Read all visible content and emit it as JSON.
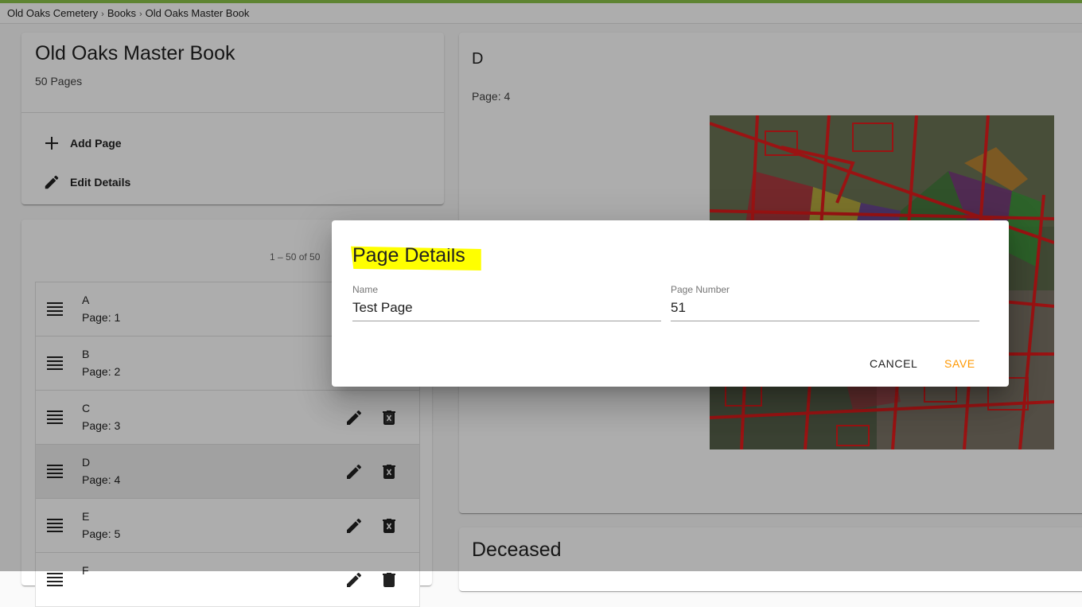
{
  "breadcrumb": [
    "Old Oaks Cemetery",
    "Books",
    "Old Oaks Master Book"
  ],
  "book": {
    "title": "Old Oaks Master Book",
    "page_count": "50 Pages",
    "add_page": "Add Page",
    "edit_details": "Edit Details"
  },
  "list": {
    "paging": "1 – 50 of 50",
    "rows": [
      {
        "name": "A",
        "page": "Page: 1"
      },
      {
        "name": "B",
        "page": "Page: 2"
      },
      {
        "name": "C",
        "page": "Page: 3"
      },
      {
        "name": "D",
        "page": "Page: 4"
      },
      {
        "name": "E",
        "page": "Page: 5"
      },
      {
        "name": "F",
        "page": ""
      }
    ],
    "selected_index": 3
  },
  "detail": {
    "title": "D",
    "page": "Page: 4"
  },
  "deceased": {
    "title": "Deceased"
  },
  "dialog": {
    "title": "Page Details",
    "name_label": "Name",
    "name_value": "Test Page",
    "number_label": "Page Number",
    "number_value": "51",
    "cancel": "CANCEL",
    "save": "SAVE"
  },
  "colors": {
    "accent": "#8bc34a",
    "save": "#ff9800",
    "highlight": "#ffff00"
  },
  "icons": [
    "plus-icon",
    "pencil-icon",
    "drag-handle-icon",
    "delete-icon",
    "chevron-right-icon"
  ]
}
